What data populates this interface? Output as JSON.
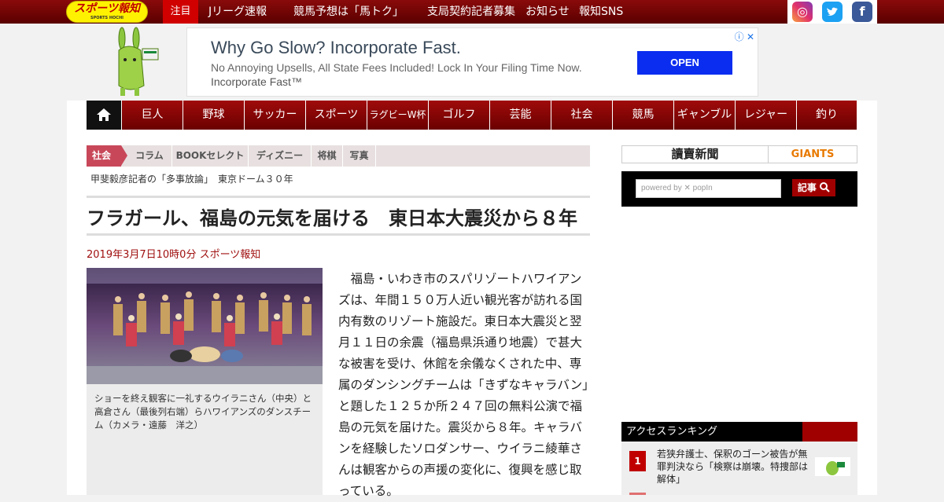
{
  "topbar": {
    "logo_text": "スポーツ報知",
    "logo_sub": "SPORTS HOCHI",
    "featured_label": "注目",
    "links": [
      "Jリーグ速報",
      "競馬予想は「馬トク」",
      "支局契約記者募集",
      "お知らせ",
      "報知SNS"
    ],
    "social": [
      {
        "icon": "instagram-icon",
        "color": "#e1306c"
      },
      {
        "icon": "twitter-icon",
        "color": "#1da1f2"
      },
      {
        "icon": "facebook-icon",
        "color": "#3b5998"
      }
    ]
  },
  "ad": {
    "title": "Why Go Slow? Incorporate Fast.",
    "text": "No Annoying Upsells, All State Fees Included! Lock In Your Filing Time Now.",
    "brand": "Incorporate Fast™",
    "button": "OPEN",
    "close": "ⓘ ✕"
  },
  "main_nav": [
    "巨人",
    "野球",
    "サッカー",
    "スポーツ",
    "ラグビーW杯",
    "ゴルフ",
    "芸能",
    "社会",
    "競馬",
    "ギャンブル",
    "レジャー",
    "釣り"
  ],
  "sub_nav": {
    "section": "社会",
    "items": [
      "コラム",
      "BOOKセレクト",
      "ディズニー",
      "将棋",
      "写真"
    ]
  },
  "breadcrumbs": "甲斐毅彦記者の「多事放論」　東京ドーム３０年",
  "article": {
    "headline": "フラガール、福島の元気を届ける　東日本大震災から８年",
    "byline": "2019年3月7日10時0分  スポーツ報知",
    "caption": "ショーを終え観客に一礼するウイラニさん（中央）と高倉さん（最後列右端）らハワイアンズのダンスチーム（カメラ・遠藤　洋之）",
    "body": "福島・いわき市のスパリゾートハワイアンズは、年間１５０万人近い観光客が訪れる国内有数のリゾート施設だ。東日本大震災と翌月１１日の余震（福島県浜通り地震）で甚大な被害を受け、休館を余儀なくされた中、専属のダンシングチームは「きずなキャラバン」と題した１２５か所２４７回の無料公演で福島の元気を届けた。震災から８年。キャラバンを経験したソロダンサー、ウイラニ綾華さんは観客からの声援の変化に、復興を感じ取っている。"
  },
  "sidebar": {
    "yomiuri": "讀賣新聞",
    "giants": "GIANTS",
    "search_placeholder": "powered by ✕ popIn",
    "search_button": "記事",
    "ranking_title": "アクセスランキング",
    "ranking": [
      {
        "rank": "1",
        "text": "若狭弁護士、保釈のゴーン被告が無罪判決なら「検察は崩壊。特捜部は解体」"
      }
    ]
  }
}
